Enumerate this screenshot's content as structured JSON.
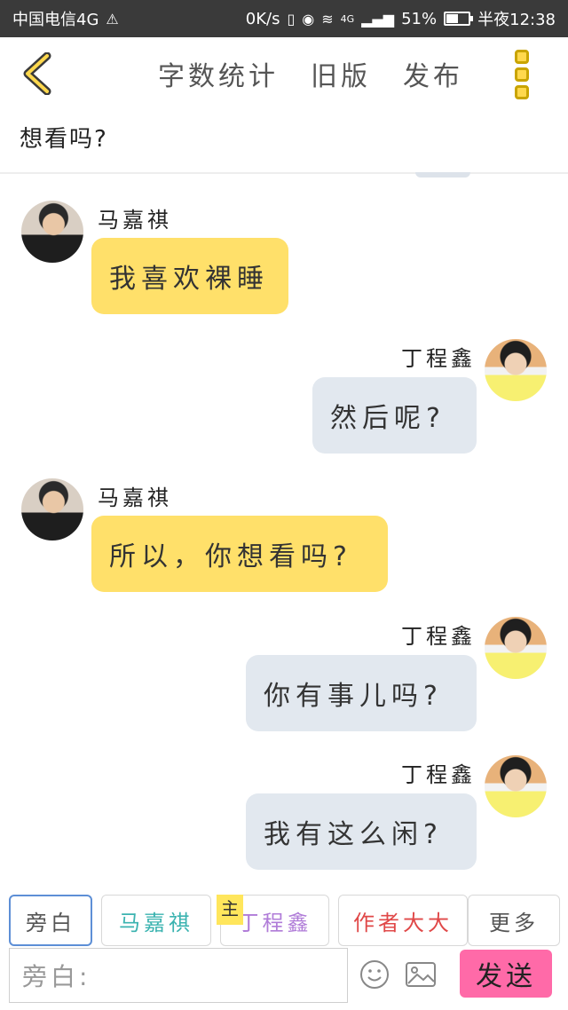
{
  "status_bar": {
    "carrier": "中国电信4G",
    "speed": "0K/s",
    "signal_label": "4G",
    "battery": "51%",
    "time": "半夜12:38"
  },
  "nav": {
    "back_icon": "chevron-left-icon",
    "actions": [
      "字数统计",
      "旧版",
      "发布"
    ],
    "more_icon": "three-dots-vertical-icon",
    "accent_color": "#ffd84d"
  },
  "chapter": {
    "title": "想看吗?"
  },
  "messages": [
    {
      "side": "left",
      "name": "马嘉祺",
      "text": "我喜欢裸睡"
    },
    {
      "side": "right",
      "name": "丁程鑫",
      "text": "然后呢?"
    },
    {
      "side": "left",
      "name": "马嘉祺",
      "text": "所以，你想看吗?"
    },
    {
      "side": "right",
      "name": "丁程鑫",
      "text": "你有事儿吗?"
    },
    {
      "side": "right",
      "name": "丁程鑫",
      "text": "我有这么闲?"
    }
  ],
  "roles": [
    {
      "label": "旁白",
      "color": "#555555",
      "active": true
    },
    {
      "label": "马嘉祺",
      "color": "#3bb3b0"
    },
    {
      "label": "丁程鑫",
      "color": "#b07cd8"
    },
    {
      "label": "作者大大",
      "color": "#e04848"
    },
    {
      "label": "更多",
      "color": "#555555"
    }
  ],
  "main_badge": "主",
  "input": {
    "placeholder": "旁白:"
  },
  "send_label": "发送",
  "icons": {
    "emoji": "emoji-icon",
    "image": "image-icon"
  }
}
